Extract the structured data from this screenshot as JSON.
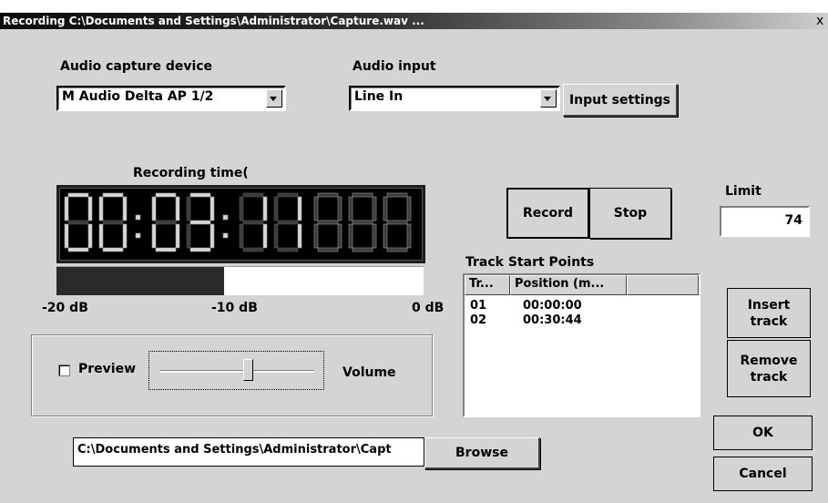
{
  "window": {
    "title": "Recording C:\\Documents and Settings\\Administrator\\Capture.wav ...",
    "close_glyph": "x"
  },
  "capture": {
    "label": "Audio capture device",
    "value": "M Audio Delta AP 1/2"
  },
  "audio_input": {
    "label": "Audio input",
    "value": "Line In",
    "settings_button": "Input settings"
  },
  "recording_time": {
    "label": "Recording time(",
    "display": "00:03:11",
    "digits": [
      "0",
      "0",
      "0",
      "3",
      "1",
      "1"
    ]
  },
  "meter": {
    "level_fraction": 0.46,
    "labels": [
      "-20 dB",
      "-10 dB",
      "0 dB"
    ]
  },
  "controls": {
    "record": "Record",
    "stop": "Stop"
  },
  "limit": {
    "label": "Limit",
    "value": "74"
  },
  "tracks": {
    "label": "Track Start Points",
    "columns": [
      "Tr...",
      "Position (m..."
    ],
    "rows": [
      {
        "track": "01",
        "position": "00:00:00"
      },
      {
        "track": "02",
        "position": "00:30:44"
      }
    ],
    "insert": "Insert track",
    "remove": "Remove track"
  },
  "preview": {
    "checkbox_label": "Preview",
    "checked": false,
    "volume_label": "Volume",
    "volume_level": 0.57
  },
  "output": {
    "path": "C:\\Documents and Settings\\Administrator\\Capt",
    "browse": "Browse"
  },
  "dialog": {
    "ok": "OK",
    "cancel": "Cancel"
  },
  "colors": {
    "led_on": "#d8d8d8",
    "led_off": "#3a3a3a",
    "face": "#d4d4d4"
  }
}
